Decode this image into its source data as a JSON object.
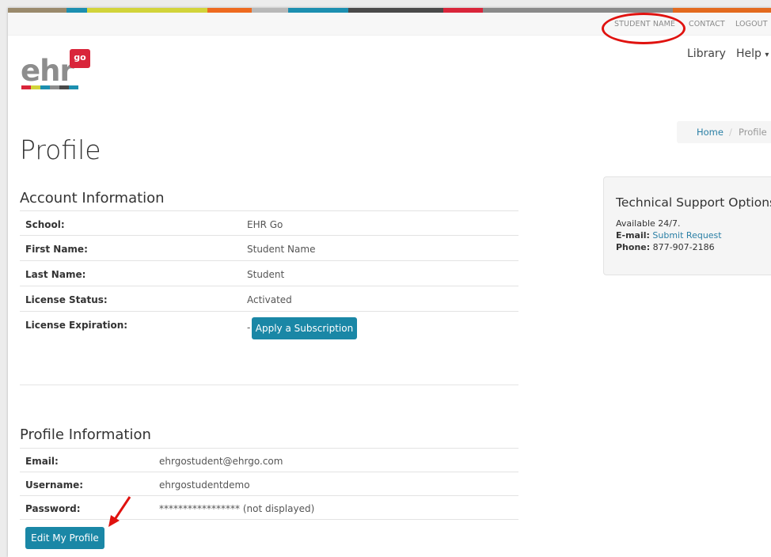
{
  "colors": {
    "top_bar_segments": [
      "#9a8a6c",
      "#1c8fb0",
      "#d2d43a",
      "#ee6a1f",
      "#b8b8b8",
      "#1c8fb0",
      "#4a4a4a",
      "#d9253a",
      "#8a8a8a",
      "#e36a1e"
    ],
    "logo_stripes": [
      "#d9253a",
      "#d2d43a",
      "#1c8fb0",
      "#8d8d8d",
      "#4a4a4a",
      "#1c8fb0"
    ],
    "primary_button": "#1a87a6",
    "link": "#2a7fa5",
    "annotation": "#e0120f"
  },
  "topbar": {
    "student_name": "STUDENT NAME",
    "contact": "CONTACT",
    "logout": "LOGOUT"
  },
  "logo": {
    "main": "ehr",
    "badge": "go"
  },
  "nav": {
    "library": "Library",
    "help": "Help",
    "help_caret": "▾"
  },
  "breadcrumb": {
    "home": "Home",
    "separator": "/",
    "current": "Profile"
  },
  "page_title": "Profile",
  "account": {
    "title": "Account Information",
    "rows": [
      {
        "label": "School:",
        "value": "EHR Go"
      },
      {
        "label": "First Name:",
        "value": "Student Name"
      },
      {
        "label": "Last Name:",
        "value": "Student"
      },
      {
        "label": "License Status:",
        "value": "Activated"
      },
      {
        "label": "License Expiration:",
        "value": "-"
      }
    ],
    "subscribe_button": "Apply a Subscription"
  },
  "profile": {
    "title": "Profile Information",
    "rows": [
      {
        "label": "Email:",
        "value": "ehrgostudent@ehrgo.com"
      },
      {
        "label": "Username:",
        "value": "ehrgostudentdemo"
      },
      {
        "label": "Password:",
        "value": "***************** (not displayed)"
      }
    ],
    "edit_button": "Edit My Profile"
  },
  "support": {
    "title": "Technical Support Options",
    "availability": "Available 24/7.",
    "email_label": "E-mail:",
    "email_link": "Submit Request",
    "phone_label": "Phone:",
    "phone": "877-907-2186"
  }
}
